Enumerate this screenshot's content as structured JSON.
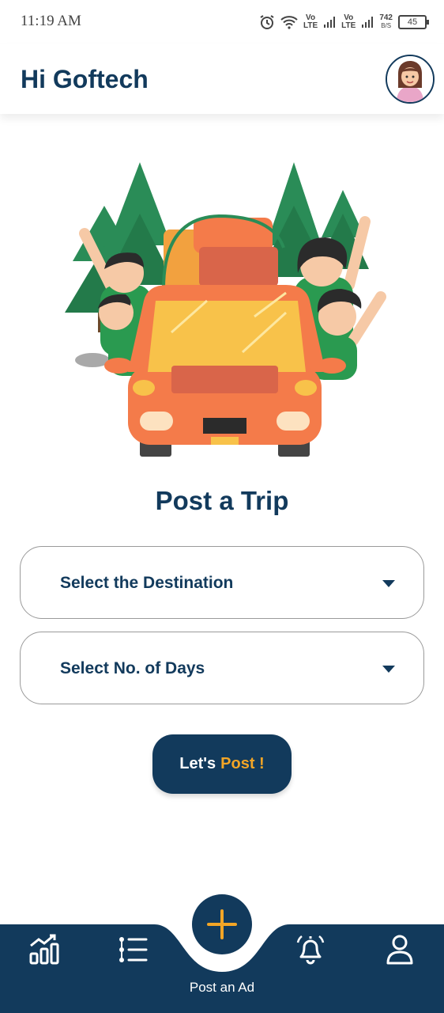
{
  "status_bar": {
    "time": "11:19 AM",
    "net_speed_value": "742",
    "net_speed_unit": "B/S",
    "battery": "45",
    "volte1": "Vo\nLTE",
    "volte2": "Vo\nLTE"
  },
  "header": {
    "greeting": "Hi Goftech",
    "avatar_icon": "avatar-girl"
  },
  "main": {
    "title": "Post a Trip",
    "destination_select": {
      "label": "Select the Destination"
    },
    "days_select": {
      "label": "Select No. of Days"
    },
    "post_button": {
      "label": "Let's",
      "accent": "Post !"
    }
  },
  "bottom_nav": {
    "items": [
      {
        "icon": "analytics-icon"
      },
      {
        "icon": "list-icon"
      },
      {
        "icon": "notification-icon"
      },
      {
        "icon": "profile-icon"
      }
    ],
    "fab": {
      "icon": "plus-icon",
      "label": "Post an Ad"
    }
  },
  "colors": {
    "primary": "#123a5c",
    "accent": "#f2a526",
    "car": "#f47b4a",
    "tree": "#2a8c57"
  }
}
